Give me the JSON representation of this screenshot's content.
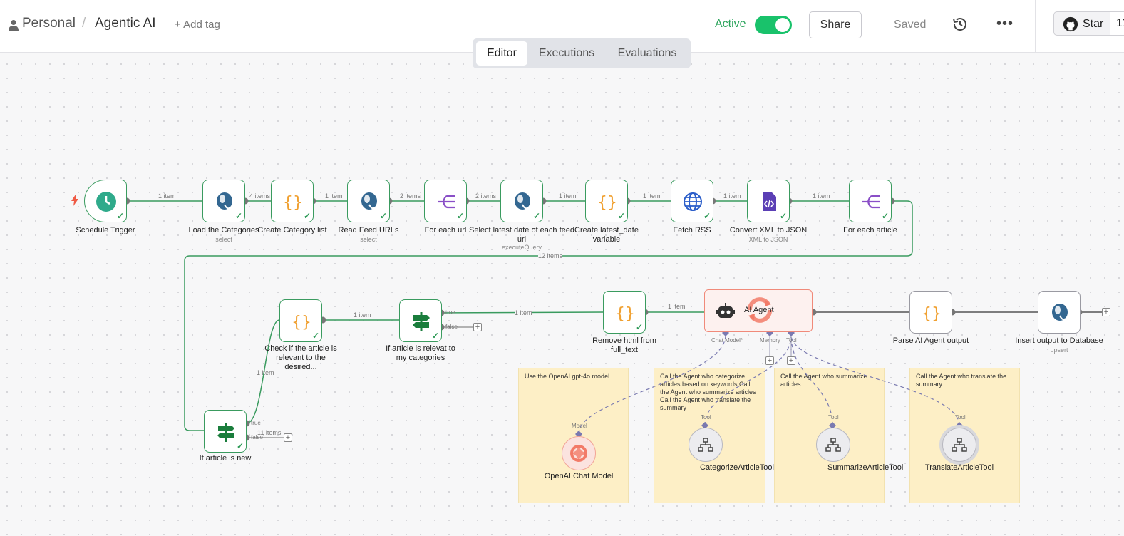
{
  "header": {
    "breadcrumb_owner": "Personal",
    "breadcrumb_sep": "/",
    "workflow_name": "Agentic AI",
    "add_tag": "+ Add tag",
    "active_label": "Active",
    "active": true,
    "share": "Share",
    "saved": "Saved",
    "more": "•••",
    "github_star": "Star",
    "github_count": "11"
  },
  "tabs": [
    {
      "label": "Editor",
      "selected": true
    },
    {
      "label": "Executions",
      "selected": false
    },
    {
      "label": "Evaluations",
      "selected": false
    }
  ],
  "nodes": {
    "schedule_trigger": {
      "label": "Schedule Trigger"
    },
    "load_categories": {
      "label": "Load the Categories",
      "sub": "select"
    },
    "create_category_list": {
      "label": "Create Category list"
    },
    "read_feed_urls": {
      "label": "Read Feed URLs",
      "sub": "select"
    },
    "for_each_url": {
      "label": "For each url"
    },
    "select_latest_date": {
      "label": "Select latest date of each feed url",
      "sub": "executeQuery"
    },
    "create_latest_date": {
      "label": "Create latest_date variable"
    },
    "fetch_rss": {
      "label": "Fetch RSS"
    },
    "convert_xml": {
      "label": "Convert XML to JSON",
      "sub": "XML to JSON"
    },
    "for_each_article": {
      "label": "For each article"
    },
    "if_article_new": {
      "label": "If article is new"
    },
    "check_relevant": {
      "label": "Check if the article is relevant to the desired..."
    },
    "if_relevat": {
      "label": "If article is relevat to my categories"
    },
    "remove_html": {
      "label": "Remove html from full_text"
    },
    "ai_agent": {
      "label": "AI Agent"
    },
    "parse_output": {
      "label": "Parse AI Agent output"
    },
    "insert_output": {
      "label": "Insert output to Database",
      "sub": "upsert"
    },
    "openai_model": {
      "label": "OpenAI Chat Model"
    },
    "categorize_tool": {
      "label": "CategorizeArticleTool"
    },
    "summarize_tool": {
      "label": "SummarizeArticleTool"
    },
    "translate_tool": {
      "label": "TranslateArticleTool"
    }
  },
  "edges": {
    "e1": "1 item",
    "e2": "4 items",
    "e3": "1 item",
    "e4": "2 items",
    "e5": "2 items",
    "e6": "1 item",
    "e7": "1 item",
    "e8": "1 item",
    "e9": "1 item",
    "e10": "12 items",
    "e11": "1 item",
    "e12": "1 item",
    "e13": "1 item",
    "e14": "1 item",
    "e15": "11 items"
  },
  "ports": {
    "true": "true",
    "false": "false",
    "chat_model": "Chat Model*",
    "memory": "Memory",
    "tool": "Tool",
    "model": "Model"
  },
  "stickies": {
    "s1": "Use the OpenAI gpt-4o model",
    "s2": "Call the Agent who categorize articles based on keywords Call the Agent who summarize articles Call the Agent who translate the summary",
    "s3": "Call the Agent who summarize articles",
    "s4": "Call the Agent who translate the summary"
  },
  "colors": {
    "success": "#3a9b5f",
    "agent_border": "#f08a7a",
    "sticky": "#fdefc6",
    "toggle_on": "#19c26b"
  }
}
